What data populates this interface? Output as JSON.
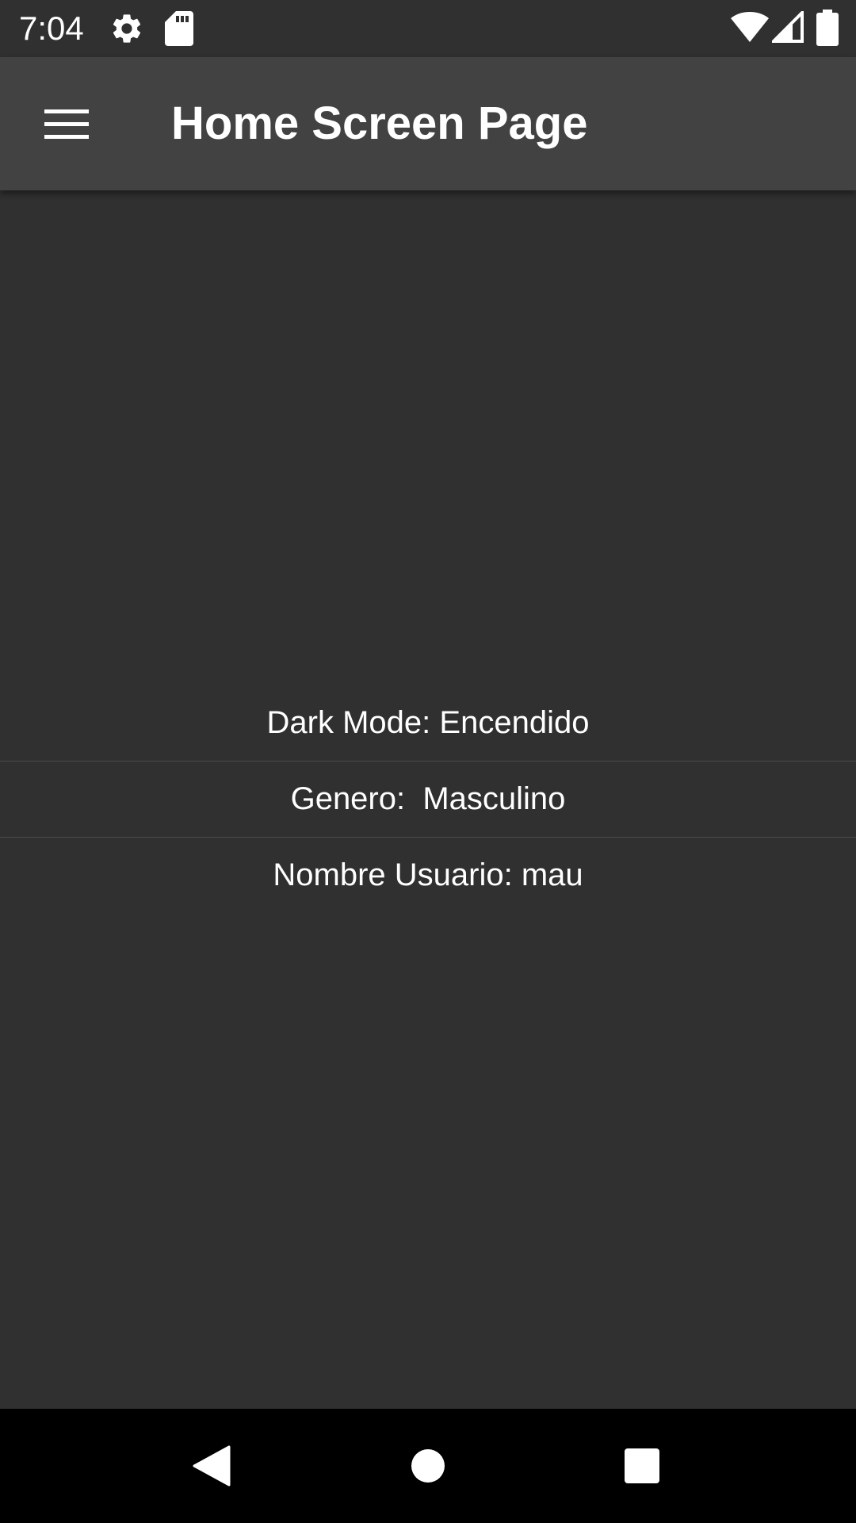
{
  "status_bar": {
    "time": "7:04",
    "icons": [
      "settings-icon",
      "sd-card-icon",
      "wifi-icon",
      "cell-signal-icon",
      "battery-icon"
    ]
  },
  "app_bar": {
    "title": "Home Screen Page",
    "menu_icon": "hamburger-menu-icon"
  },
  "info": {
    "dark_mode": "Dark Mode: Encendido",
    "genero": "Genero:  Masculino",
    "nombre_usuario": "Nombre Usuario: mau"
  },
  "nav_bar": {
    "icons": [
      "back-icon",
      "home-icon",
      "recents-icon"
    ]
  },
  "colors": {
    "background": "#303030",
    "app_bar": "#424242",
    "nav_bar": "#000000",
    "text": "#ffffff"
  }
}
